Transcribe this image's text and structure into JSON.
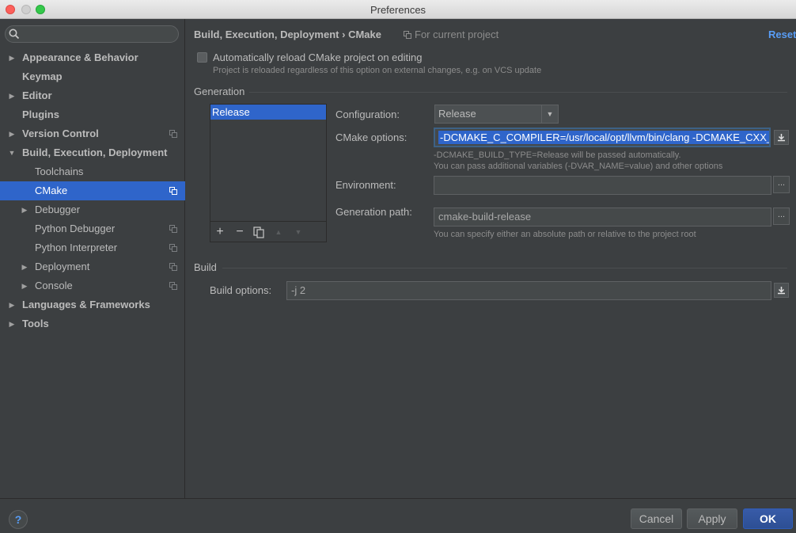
{
  "window": {
    "title": "Preferences"
  },
  "sidebar": {
    "search": {
      "placeholder": ""
    },
    "items": [
      {
        "label": "Appearance & Behavior",
        "expandable": true,
        "expanded": false,
        "bold": true,
        "level": 0,
        "project": false
      },
      {
        "label": "Keymap",
        "expandable": false,
        "bold": true,
        "level": 0,
        "project": false
      },
      {
        "label": "Editor",
        "expandable": true,
        "expanded": false,
        "bold": true,
        "level": 0,
        "project": false
      },
      {
        "label": "Plugins",
        "expandable": false,
        "bold": true,
        "level": 0,
        "project": false
      },
      {
        "label": "Version Control",
        "expandable": true,
        "expanded": false,
        "bold": true,
        "level": 0,
        "project": true
      },
      {
        "label": "Build, Execution, Deployment",
        "expandable": true,
        "expanded": true,
        "bold": true,
        "level": 0,
        "project": false
      },
      {
        "label": "Toolchains",
        "expandable": false,
        "bold": false,
        "level": 1,
        "project": false
      },
      {
        "label": "CMake",
        "expandable": false,
        "bold": false,
        "level": 1,
        "project": true,
        "selected": true
      },
      {
        "label": "Debugger",
        "expandable": true,
        "expanded": false,
        "bold": false,
        "level": 1,
        "project": false
      },
      {
        "label": "Python Debugger",
        "expandable": false,
        "bold": false,
        "level": 1,
        "project": true
      },
      {
        "label": "Python Interpreter",
        "expandable": false,
        "bold": false,
        "level": 1,
        "project": true
      },
      {
        "label": "Deployment",
        "expandable": true,
        "expanded": false,
        "bold": false,
        "level": 1,
        "project": true
      },
      {
        "label": "Console",
        "expandable": true,
        "expanded": false,
        "bold": false,
        "level": 1,
        "project": true
      },
      {
        "label": "Languages & Frameworks",
        "expandable": true,
        "expanded": false,
        "bold": true,
        "level": 0,
        "project": false
      },
      {
        "label": "Tools",
        "expandable": true,
        "expanded": false,
        "bold": true,
        "level": 0,
        "project": false
      }
    ]
  },
  "header": {
    "breadcrumb_parent": "Build, Execution, Deployment",
    "breadcrumb_sep": "›",
    "breadcrumb_current": "CMake",
    "scope": "For current project",
    "reset": "Reset"
  },
  "auto_reload": {
    "checked": false,
    "label": "Automatically reload CMake project on editing",
    "hint": "Project is reloaded regardless of this option on external changes, e.g. on VCS update"
  },
  "generation": {
    "section_title": "Generation",
    "profiles": [
      "Release"
    ],
    "toolbar": {
      "add": "+",
      "remove": "−",
      "copy": "copy-icon",
      "up": "▲",
      "down": "▼"
    },
    "configuration_label": "Configuration:",
    "configuration_value": "Release",
    "cmake_options_label": "CMake options:",
    "cmake_options_value": "-DCMAKE_C_COMPILER=/usr/local/opt/llvm/bin/clang -DCMAKE_CXX_COMPILER=/usr/local/opt/llvm/bin/clang++",
    "cmake_hint_1": "-DCMAKE_BUILD_TYPE=Release will be passed automatically.",
    "cmake_hint_2": "You can pass additional variables (-DVAR_NAME=value) and other options",
    "environment_label": "Environment:",
    "environment_value": "",
    "generation_path_label": "Generation path:",
    "generation_path_value": "cmake-build-release",
    "generation_path_hint": "You can specify either an absolute path or relative to the project root",
    "browse_label": "..."
  },
  "build": {
    "section_title": "Build",
    "build_options_label": "Build options:",
    "build_options_value": "-j 2"
  },
  "footer": {
    "help": "?",
    "cancel": "Cancel",
    "apply": "Apply",
    "ok": "OK"
  },
  "colors": {
    "background": "#3c3f41",
    "selection": "#2f65ca",
    "link": "#589df6",
    "text": "#bbbbbb"
  }
}
